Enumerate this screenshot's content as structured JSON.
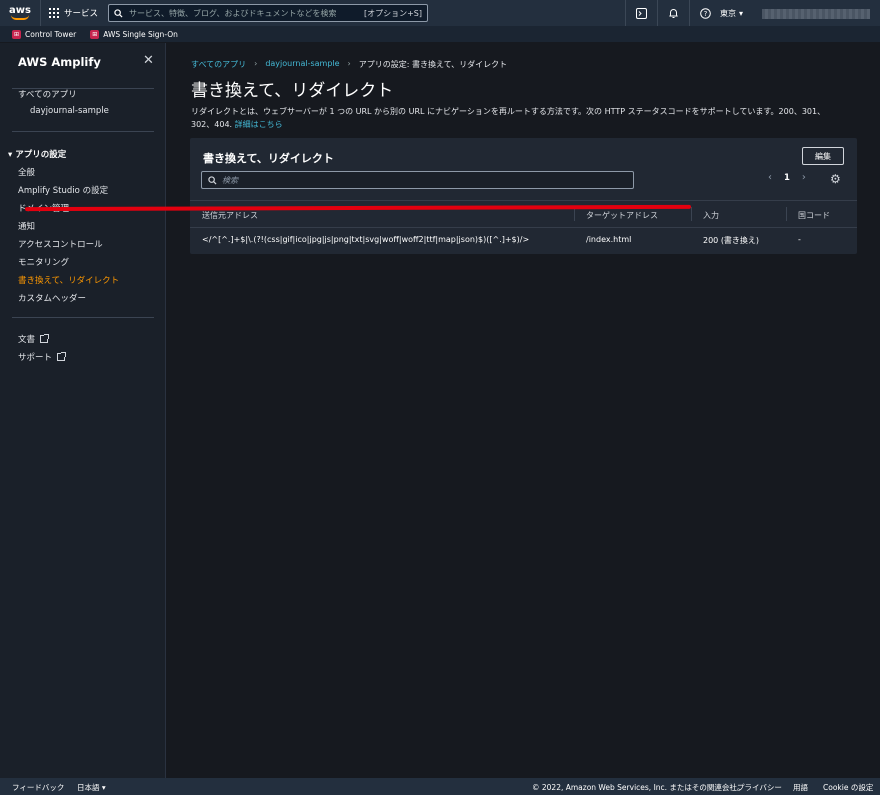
{
  "topbar": {
    "logo": "aws",
    "services_label": "サービス",
    "search_placeholder": "サービス、特徴、ブログ、およびドキュメントなどを検索",
    "search_shortcut": "[オプション+S]",
    "region": "東京",
    "icons": [
      "cloudshell-icon",
      "notification-bell-icon",
      "help-icon"
    ]
  },
  "bookmarks": [
    {
      "label": "Control Tower",
      "icon": "control-tower-icon"
    },
    {
      "label": "AWS Single Sign-On",
      "icon": "sso-icon"
    }
  ],
  "sidebar": {
    "title": "AWS Amplify",
    "all_apps": "すべてのアプリ",
    "app_name": "dayjournal-sample",
    "section_title": "アプリの設定",
    "items": [
      "全般",
      "Amplify Studio の設定",
      "ドメイン管理",
      "通知",
      "アクセスコントロール",
      "モニタリング",
      "書き換えて、リダイレクト",
      "カスタムヘッダー"
    ],
    "active_item": "書き換えて、リダイレクト",
    "links": [
      "文書",
      "サポート"
    ]
  },
  "breadcrumb": {
    "items": [
      "すべてのアプリ",
      "dayjournal-sample",
      "アプリの設定: 書き換えて、リダイレクト"
    ]
  },
  "page": {
    "title": "書き換えて、リダイレクト",
    "description": "リダイレクトとは、ウェブサーバーが 1 つの URL から別の URL にナビゲーションを再ルートする方法です。次の HTTP ステータスコードをサポートしています。200、301、302、404.",
    "learn_more": "詳細はこちら"
  },
  "panel": {
    "title": "書き換えて、リダイレクト",
    "edit_button": "編集",
    "filter_placeholder": "検索",
    "page_number": "1",
    "columns": [
      "送信元アドレス",
      "ターゲットアドレス",
      "入力",
      "国コード"
    ],
    "rows": [
      {
        "source": "</^[^.]+$|\\.(?!(css|gif|ico|jpg|js|png|txt|svg|woff|woff2|ttf|map|json)$)([^.]+$)/>",
        "target": "/index.html",
        "type": "200 (書き換え)",
        "country": "-"
      }
    ]
  },
  "footer": {
    "feedback": "フィードバック",
    "language": "日本語",
    "copyright": "© 2022, Amazon Web Services, Inc. またはその関連会社。",
    "privacy": "プライバシー",
    "terms": "用語",
    "cookie": "Cookie の設定"
  },
  "colors": {
    "accent": "#ff9900",
    "link": "#44b9d6",
    "annotation": "#e3000f"
  }
}
